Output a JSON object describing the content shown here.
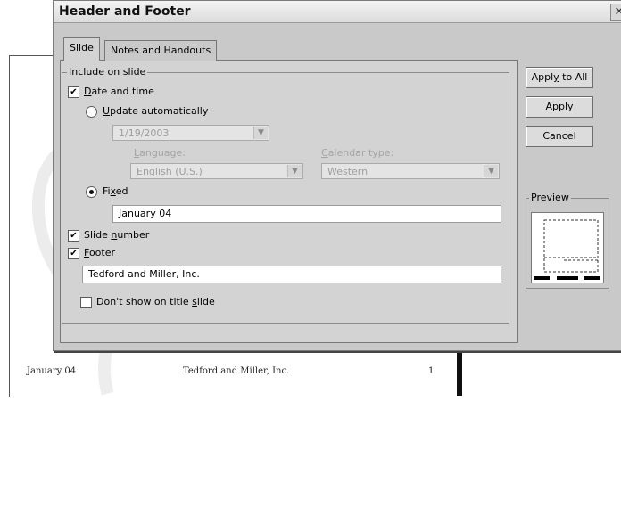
{
  "dialog": {
    "title": "Header and Footer"
  },
  "tabs": [
    {
      "label": "Slide"
    },
    {
      "label": "Notes and Handouts"
    }
  ],
  "include_group": {
    "legend": "Include on slide"
  },
  "date_time": {
    "checked": true,
    "label_key": "D",
    "label_rest": "ate and time",
    "update_auto": {
      "key": "U",
      "rest": "pdate automatically"
    },
    "date_value": "1/19/2003",
    "language": {
      "label_key": "L",
      "label_rest": "anguage:",
      "value": "English (U.S.)"
    },
    "calendar": {
      "label_key": "C",
      "label_rest": "alendar type:",
      "value": "Western"
    },
    "fixed": {
      "pre": "Fi",
      "key": "x",
      "post": "ed",
      "value": "January 04"
    }
  },
  "slide_number": {
    "checked": true,
    "pre": "Slide ",
    "key": "n",
    "post": "umber"
  },
  "footer": {
    "checked": true,
    "key": "F",
    "rest": "ooter",
    "value": "Tedford and Miller, Inc."
  },
  "dont_show": {
    "checked": false,
    "pre": "Don't show on title ",
    "key": "s",
    "post": "lide"
  },
  "buttons": {
    "apply_all": {
      "pre": "Appl",
      "key": "y",
      "post": " to All"
    },
    "apply": {
      "key": "A",
      "rest": "pply"
    },
    "cancel": "Cancel"
  },
  "preview": {
    "legend": "Preview"
  },
  "slide_footer": {
    "date": "January 04",
    "footer": "Tedford and Miller, Inc.",
    "number": "1"
  }
}
